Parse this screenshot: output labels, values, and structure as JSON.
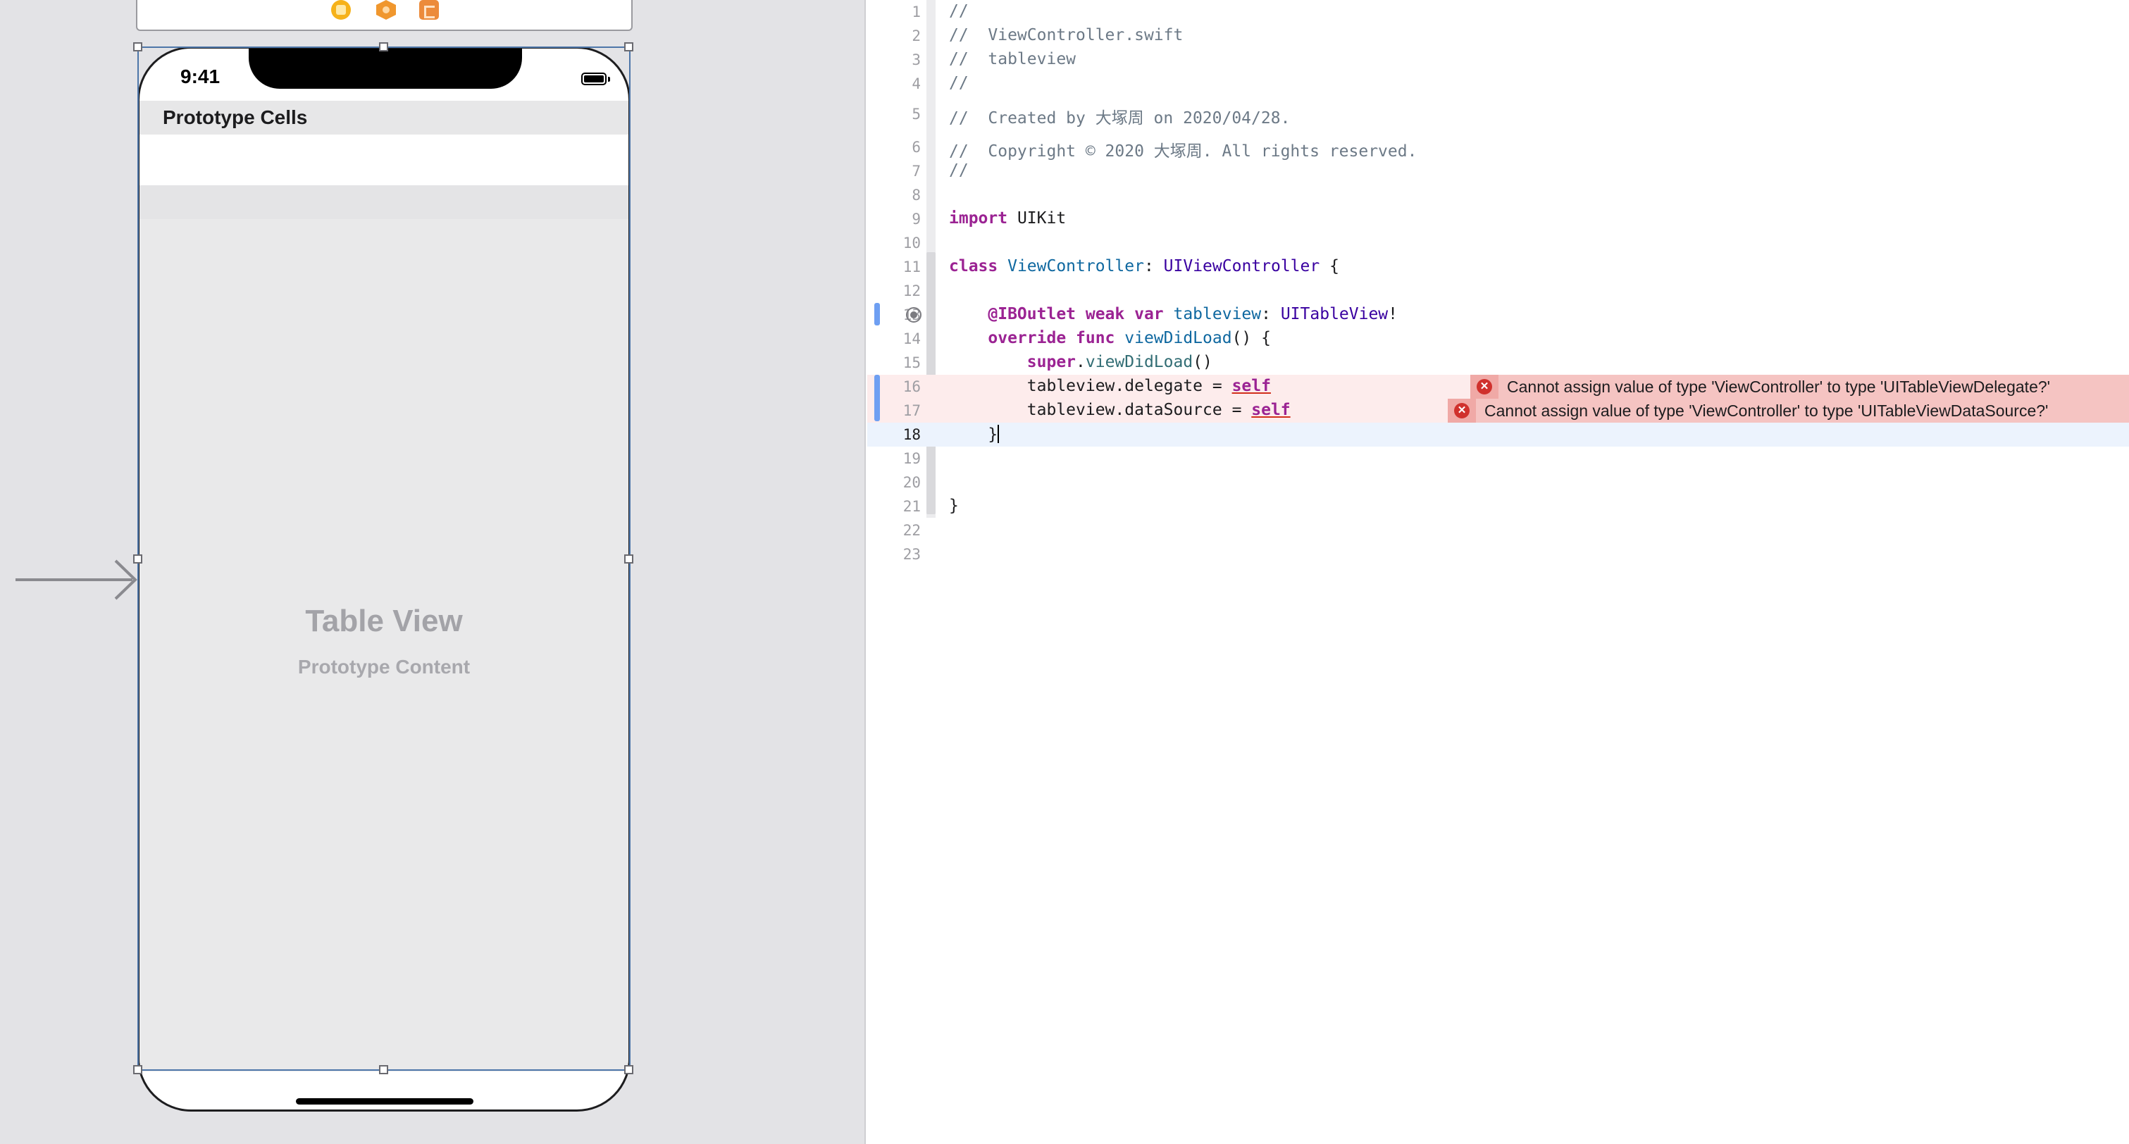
{
  "storyboard": {
    "status_time": "9:41",
    "prototype_cells_label": "Prototype Cells",
    "table_view_title": "Table View",
    "table_view_subtitle": "Prototype Content",
    "scene_dock_icons": [
      "view-controller-icon",
      "first-responder-icon",
      "exit-icon"
    ]
  },
  "editor": {
    "lines": [
      {
        "n": "1",
        "text": "//"
      },
      {
        "n": "2",
        "text": "//  ViewController.swift"
      },
      {
        "n": "3",
        "text": "//  tableview"
      },
      {
        "n": "4",
        "text": "//"
      },
      {
        "n": "5",
        "text": "//  Created by 大塚周 on 2020/04/28."
      },
      {
        "n": "6",
        "text": "//  Copyright © 2020 大塚周. All rights reserved."
      },
      {
        "n": "7",
        "text": "//"
      },
      {
        "n": "8",
        "text": ""
      },
      {
        "n": "9",
        "kw": "import",
        "rest": " UIKit"
      },
      {
        "n": "10",
        "text": ""
      },
      {
        "n": "11",
        "kw": "class",
        "decl": " ViewController",
        "sep": ": ",
        "type": "UIViewController",
        "tail": " {"
      },
      {
        "n": "12",
        "text": ""
      },
      {
        "n": "13",
        "kw": "    @IBOutlet weak var",
        "decl": " tableview",
        "sep": ": ",
        "type": "UITableView",
        "tail": "!"
      },
      {
        "n": "14",
        "kw": "    override func",
        "decl": " viewDidLoad",
        "tail": "() {"
      },
      {
        "n": "15",
        "kw": "        super",
        "sep": ".",
        "member": "viewDidLoad",
        "tail": "()"
      },
      {
        "n": "16",
        "pre": "        tableview.delegate = ",
        "self": "self"
      },
      {
        "n": "17",
        "pre": "        tableview.dataSource = ",
        "self": "self"
      },
      {
        "n": "18",
        "text": "    }"
      },
      {
        "n": "19",
        "text": ""
      },
      {
        "n": "20",
        "text": ""
      },
      {
        "n": "21",
        "text": "}"
      },
      {
        "n": "22",
        "text": ""
      },
      {
        "n": "23",
        "text": ""
      }
    ],
    "errors": [
      {
        "line": "16",
        "message": "Cannot assign value of type 'ViewController' to type 'UITableViewDelegate?'"
      },
      {
        "line": "17",
        "message": "Cannot assign value of type 'ViewController' to type 'UITableViewDataSource?'"
      }
    ],
    "current_line": "18"
  }
}
